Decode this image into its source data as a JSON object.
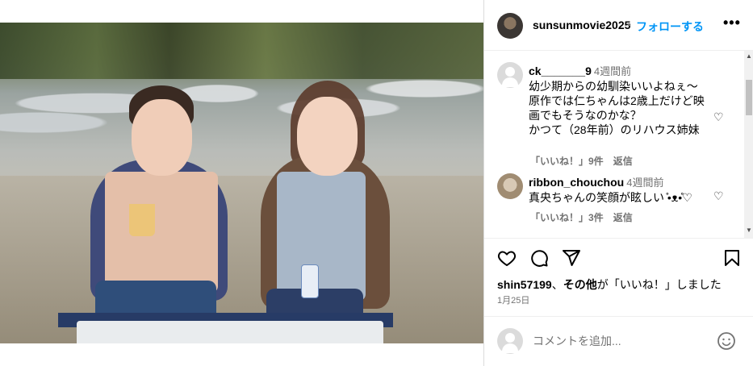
{
  "post": {
    "account": "sunsunmovie2025",
    "separator": "•",
    "follow_label": "フォローする",
    "more_label": "•••"
  },
  "comments": [
    {
      "user": "ck_______9",
      "time": "4週間前",
      "text": "幼少期からの幼馴染いいよねぇ〜\n原作では仁ちゃんは2歳上だけど映\n画でもそうなのかな？\nかつて（28年前）のリハウス姉妹",
      "likes_label": "「いいね！」9件",
      "reply_label": "返信"
    },
    {
      "user": "ribbon_chouchou",
      "time": "4週間前",
      "text": "真央ちゃんの笑顔が眩しい ̊•ᴥ•̊♡",
      "likes_label": "「いいね！」3件",
      "reply_label": "返信"
    }
  ],
  "likes_line": {
    "user": "shin57199",
    "connector": "、",
    "others": "その他",
    "suffix": "が「いいね！」しました"
  },
  "date": "1月25日",
  "add_comment": {
    "placeholder": "コメントを追加..."
  },
  "scrollbar": {
    "up": "▲",
    "down": "▼"
  },
  "icons": {
    "comment_heart": "♡"
  }
}
